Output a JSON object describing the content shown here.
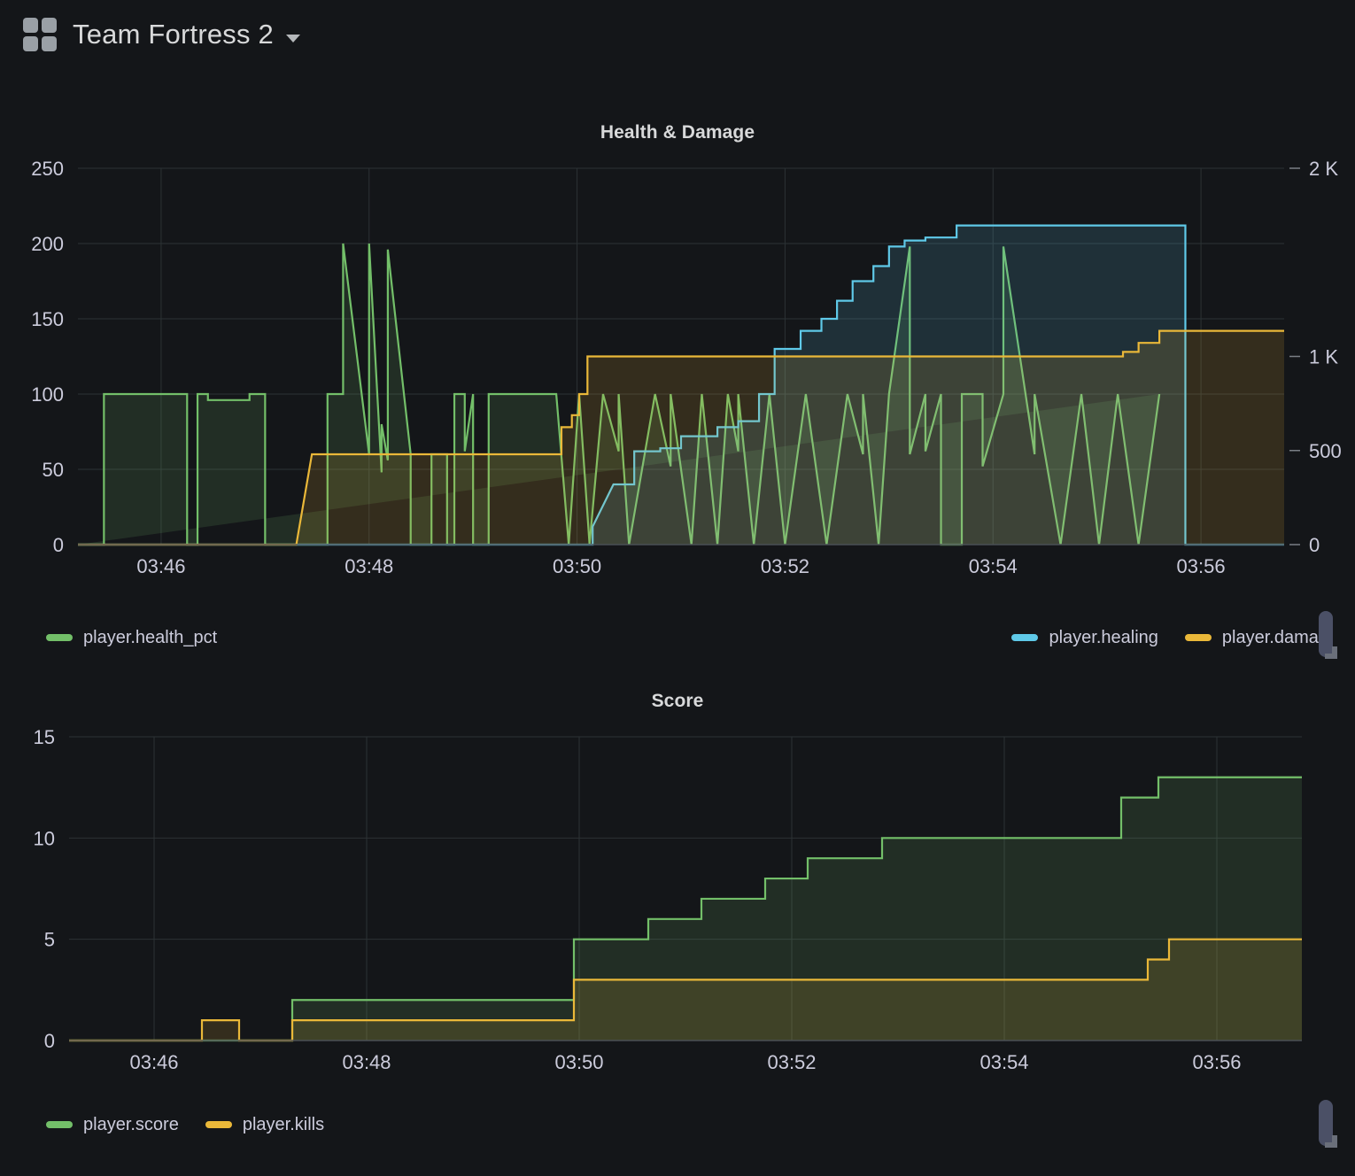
{
  "header": {
    "app_title": "Team Fortress 2",
    "grid_icon": "grid-icon",
    "caret_icon": "chevron-down-icon"
  },
  "colors": {
    "background": "#141619",
    "green": "#73bf69",
    "green_fill": "#73bf6926",
    "cyan": "#5fc9e8",
    "cyan_fill": "#5fc9e826",
    "orange": "#eab839",
    "orange_fill": "#eab83926",
    "grid": "#2c3235",
    "text": "#ccccdc",
    "scrollbar": "#4b5066"
  },
  "panels": [
    {
      "title": "Health & Damage",
      "legend_left": [
        {
          "label": "player.health_pct",
          "color": "#73bf69"
        }
      ],
      "legend_right": [
        {
          "label": "player.healing",
          "color": "#5fc9e8"
        },
        {
          "label": "player.damag",
          "color": "#eab839"
        }
      ]
    },
    {
      "title": "Score",
      "legend_left": [
        {
          "label": "player.score",
          "color": "#73bf69"
        },
        {
          "label": "player.kills",
          "color": "#eab839"
        }
      ],
      "legend_right": []
    }
  ],
  "chart_data": [
    {
      "type": "line",
      "title": "Health & Damage",
      "xlabel": "",
      "ylabel": "",
      "grid": true,
      "legend_position": "bottom",
      "x_tick_labels": [
        "03:46",
        "03:48",
        "03:50",
        "03:52",
        "03:54",
        "03:56"
      ],
      "x_tick_minutes": [
        225.6,
        227.6,
        229.6,
        231.6,
        233.6,
        235.6
      ],
      "xlim": [
        224.8,
        236.4
      ],
      "axes": [
        {
          "side": "left",
          "ylim": [
            0,
            250
          ],
          "ticks": [
            0,
            50,
            100,
            150,
            200,
            250
          ],
          "tick_labels": [
            "0",
            "50",
            "100",
            "150",
            "200",
            "250"
          ]
        },
        {
          "side": "right",
          "ylim": [
            0,
            2000
          ],
          "ticks": [
            0,
            500,
            1000,
            2000
          ],
          "tick_labels": [
            "0",
            "500",
            "1 K",
            "2 K"
          ]
        }
      ],
      "series": [
        {
          "name": "player.health_pct",
          "color": "#73bf69",
          "axis": "left",
          "step": true,
          "fill": true,
          "x": [
            224.8,
            225.05,
            225.05,
            225.85,
            225.85,
            225.95,
            225.95,
            226.05,
            226.05,
            226.45,
            226.45,
            226.6,
            226.6,
            226.95,
            226.95,
            227.2,
            227.2,
            227.35,
            227.35,
            227.6,
            227.6,
            227.72,
            227.72,
            227.78,
            227.78,
            228.0,
            228.0,
            228.12,
            228.12,
            228.2,
            228.2,
            228.35,
            228.35,
            228.42,
            228.42,
            228.52,
            228.52,
            228.6,
            228.6,
            228.75,
            228.75,
            229.4,
            229.4,
            229.52,
            229.52,
            229.62,
            229.62,
            229.72,
            229.72,
            229.85,
            229.85,
            230.0,
            230.0,
            230.1,
            230.1,
            230.35,
            230.35,
            230.5,
            230.5,
            230.7,
            230.7,
            230.8,
            230.8,
            230.95,
            230.95,
            231.05,
            231.05,
            231.15,
            231.15,
            231.3,
            231.3,
            231.45,
            231.45,
            231.6,
            231.6,
            231.8,
            231.8,
            232.0,
            232.0,
            232.2,
            232.2,
            232.35,
            232.35,
            232.5,
            232.5,
            232.6,
            232.6,
            232.8,
            232.8,
            232.95,
            232.95,
            233.1,
            233.1,
            233.3,
            233.3,
            233.5,
            233.5,
            233.7,
            233.7,
            234.0,
            234.0,
            234.25,
            234.25,
            234.45,
            234.45,
            234.62,
            234.62,
            234.8,
            234.8,
            235.0,
            235.0,
            235.2,
            235.2,
            235.4,
            235.4,
            235.55,
            235.55,
            235.7,
            235.7,
            236.4
          ],
          "y": [
            0,
            0,
            100,
            100,
            0,
            0,
            100,
            100,
            96,
            96,
            100,
            100,
            0,
            0,
            0,
            0,
            100,
            100,
            200,
            60,
            200,
            48,
            80,
            56,
            196,
            60,
            0,
            0,
            0,
            0,
            60,
            60,
            0,
            0,
            100,
            100,
            62,
            100,
            0,
            0,
            100,
            100,
            100,
            0,
            0,
            100,
            100,
            0,
            0,
            100,
            100,
            62,
            100,
            0,
            0,
            100,
            100,
            52,
            100,
            0,
            0,
            100,
            100,
            0,
            0,
            100,
            100,
            62,
            100,
            0,
            0,
            100,
            100,
            0,
            0,
            100,
            100,
            0,
            0,
            100,
            100,
            60,
            100,
            0,
            0,
            100,
            100,
            198,
            60,
            100,
            62,
            100,
            0,
            0,
            100,
            100,
            52,
            100,
            198,
            60,
            100,
            0,
            0,
            100,
            100,
            0,
            0,
            100,
            100,
            0,
            0,
            100,
            100
          ]
        },
        {
          "name": "player.healing",
          "color": "#5fc9e8",
          "axis": "left",
          "step": true,
          "fill": true,
          "x": [
            224.8,
            229.75,
            229.75,
            229.95,
            229.95,
            230.15,
            230.15,
            230.4,
            230.4,
            230.6,
            230.6,
            230.95,
            230.95,
            231.15,
            231.15,
            231.35,
            231.35,
            231.5,
            231.5,
            231.75,
            231.75,
            231.95,
            231.95,
            232.1,
            232.1,
            232.25,
            232.25,
            232.45,
            232.45,
            232.6,
            232.6,
            232.75,
            232.75,
            232.95,
            232.95,
            233.25,
            233.25,
            235.45,
            235.45,
            236.4
          ],
          "y": [
            0,
            0,
            12,
            40,
            40,
            40,
            62,
            62,
            64,
            64,
            72,
            72,
            78,
            78,
            82,
            82,
            100,
            100,
            130,
            130,
            142,
            142,
            150,
            150,
            162,
            162,
            175,
            175,
            185,
            185,
            198,
            198,
            202,
            202,
            204,
            204,
            212,
            212,
            0,
            0
          ]
        },
        {
          "name": "player.damage",
          "color": "#eab839",
          "axis": "left",
          "step": true,
          "fill": true,
          "x": [
            224.8,
            226.9,
            226.9,
            227.05,
            227.05,
            229.45,
            229.45,
            229.55,
            229.55,
            229.62,
            229.62,
            229.7,
            229.7,
            234.85,
            234.85,
            235.0,
            235.0,
            235.2,
            235.2,
            236.4
          ],
          "y": [
            0,
            0,
            0,
            60,
            60,
            60,
            78,
            78,
            86,
            86,
            100,
            100,
            125,
            125,
            128,
            128,
            134,
            134,
            142,
            142
          ]
        }
      ]
    },
    {
      "type": "line",
      "title": "Score",
      "xlabel": "",
      "ylabel": "",
      "grid": true,
      "legend_position": "bottom",
      "x_tick_labels": [
        "03:46",
        "03:48",
        "03:50",
        "03:52",
        "03:54",
        "03:56"
      ],
      "x_tick_minutes": [
        225.6,
        227.6,
        229.6,
        231.6,
        233.6,
        235.6
      ],
      "xlim": [
        224.8,
        236.4
      ],
      "axes": [
        {
          "side": "left",
          "ylim": [
            0,
            15
          ],
          "ticks": [
            0,
            5,
            10,
            15
          ],
          "tick_labels": [
            "0",
            "5",
            "10",
            "15"
          ]
        }
      ],
      "series": [
        {
          "name": "player.score",
          "color": "#73bf69",
          "axis": "left",
          "step": true,
          "fill": true,
          "x": [
            224.8,
            226.9,
            226.9,
            229.55,
            229.55,
            230.25,
            230.25,
            230.75,
            230.75,
            231.35,
            231.35,
            231.75,
            231.75,
            232.45,
            232.45,
            234.7,
            234.7,
            235.05,
            235.05,
            236.4
          ],
          "y": [
            0,
            0,
            2,
            2,
            5,
            5,
            6,
            6,
            7,
            7,
            8,
            8,
            9,
            9,
            10,
            10,
            12,
            12,
            13,
            13
          ]
        },
        {
          "name": "player.kills",
          "color": "#eab839",
          "axis": "left",
          "step": true,
          "fill": true,
          "x": [
            224.8,
            226.05,
            226.05,
            226.4,
            226.4,
            226.9,
            226.9,
            229.55,
            229.55,
            234.95,
            234.95,
            235.15,
            235.15,
            236.4
          ],
          "y": [
            0,
            0,
            1,
            1,
            0,
            0,
            1,
            1,
            3,
            3,
            4,
            4,
            5,
            5
          ]
        }
      ]
    }
  ]
}
